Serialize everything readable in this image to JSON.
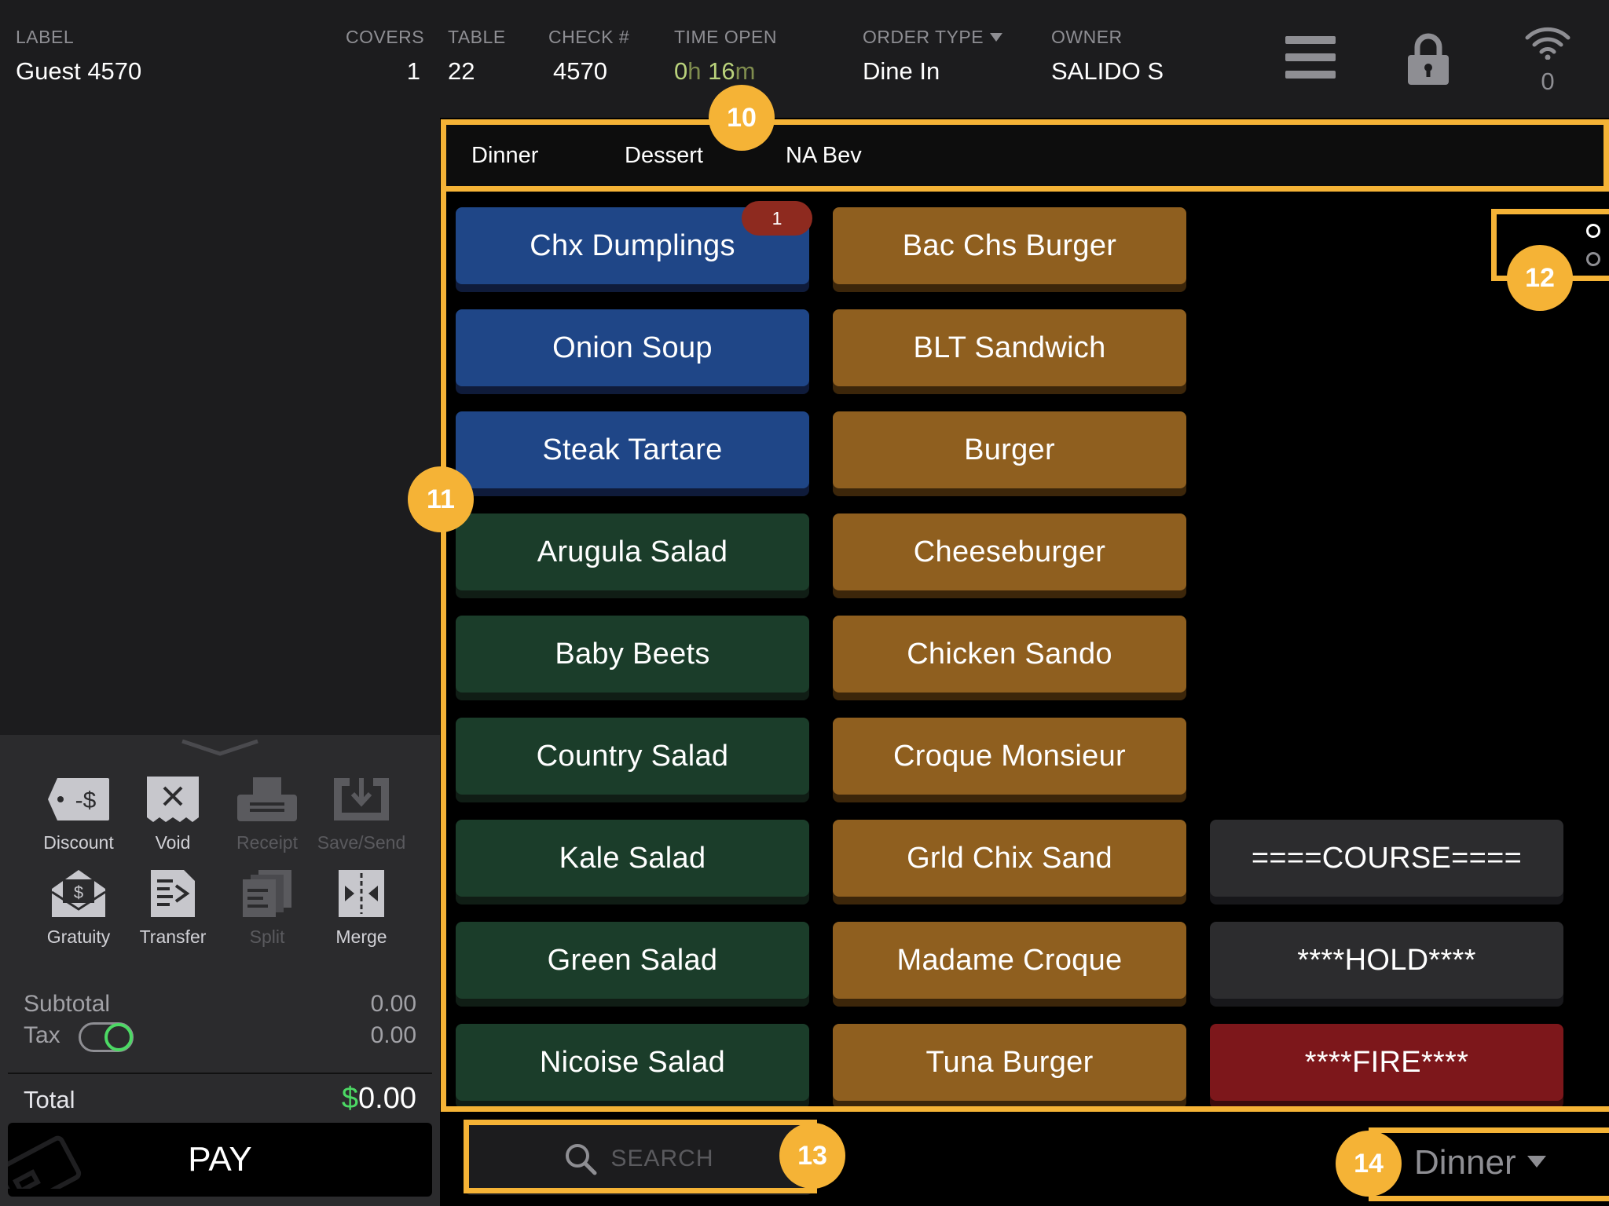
{
  "header": {
    "label": {
      "title": "LABEL",
      "value": "Guest 4570"
    },
    "covers": {
      "title": "COVERS",
      "value": "1"
    },
    "table": {
      "title": "TABLE",
      "value": "22"
    },
    "check": {
      "title": "CHECK #",
      "value": "4570"
    },
    "time_open": {
      "title": "TIME OPEN",
      "hours": "0",
      "hours_unit": "h",
      "minutes": "16",
      "minutes_unit": "m"
    },
    "order_type": {
      "title": "ORDER TYPE",
      "value": "Dine In"
    },
    "owner": {
      "title": "OWNER",
      "value": "SALIDO S"
    },
    "icons": {
      "menu": "hamburger-menu-icon",
      "lock": "lock-icon",
      "wifi": "wifi-icon"
    },
    "wifi_count": "0"
  },
  "actions": [
    {
      "label": "Discount",
      "icon": "discount-tag-icon",
      "enabled": true
    },
    {
      "label": "Void",
      "icon": "void-receipt-icon",
      "enabled": true
    },
    {
      "label": "Receipt",
      "icon": "printer-icon",
      "enabled": false
    },
    {
      "label": "Save/Send",
      "icon": "save-send-icon",
      "enabled": false
    },
    {
      "label": "Gratuity",
      "icon": "gratuity-envelope-icon",
      "enabled": true
    },
    {
      "label": "Transfer",
      "icon": "transfer-icon",
      "enabled": true
    },
    {
      "label": "Split",
      "icon": "split-icon",
      "enabled": false
    },
    {
      "label": "Merge",
      "icon": "merge-icon",
      "enabled": true
    }
  ],
  "totals": {
    "subtotal_label": "Subtotal",
    "subtotal_value": "0.00",
    "tax_label": "Tax",
    "tax_value": "0.00",
    "tax_enabled": true,
    "total_label": "Total",
    "total_currency": "$",
    "total_value": "0.00"
  },
  "pay_label": "PAY",
  "categories": [
    "Dinner",
    "Dessert",
    "NA Bev"
  ],
  "items": {
    "column1": [
      {
        "label": "Chx Dumplings",
        "color": "#1f4687"
      },
      {
        "label": "Onion Soup",
        "color": "#1f4687"
      },
      {
        "label": "Steak Tartare",
        "color": "#1f4687"
      },
      {
        "label": "Arugula Salad",
        "color": "#1b3d2a"
      },
      {
        "label": "Baby Beets",
        "color": "#1b3d2a"
      },
      {
        "label": "Country Salad",
        "color": "#1b3d2a"
      },
      {
        "label": "Kale Salad",
        "color": "#1b3d2a"
      },
      {
        "label": "Green Salad",
        "color": "#1b3d2a"
      },
      {
        "label": "Nicoise Salad",
        "color": "#1b3d2a"
      }
    ],
    "column2": [
      {
        "label": "Bac Chs Burger",
        "color": "#8f5f1f"
      },
      {
        "label": "BLT Sandwich",
        "color": "#8f5f1f"
      },
      {
        "label": "Burger",
        "color": "#8f5f1f"
      },
      {
        "label": "Cheeseburger",
        "color": "#8f5f1f"
      },
      {
        "label": "Chicken Sando",
        "color": "#8f5f1f"
      },
      {
        "label": "Croque Monsieur",
        "color": "#8f5f1f"
      },
      {
        "label": "Grld Chix Sand",
        "color": "#8f5f1f"
      },
      {
        "label": "Madame Croque",
        "color": "#8f5f1f"
      },
      {
        "label": "Tuna Burger",
        "color": "#8f5f1f"
      }
    ],
    "column3": [
      {
        "label": "====COURSE====",
        "color": "#2c2c2e"
      },
      {
        "label": "****HOLD****",
        "color": "#2c2c2e"
      },
      {
        "label": "****FIRE****",
        "color": "#7d171b"
      }
    ],
    "badge_count": "1"
  },
  "pagination": {
    "pages": 2,
    "current": 1
  },
  "search": {
    "placeholder": "SEARCH"
  },
  "menu_selector": {
    "value": "Dinner"
  },
  "callouts": [
    "10",
    "11",
    "12",
    "13",
    "14"
  ],
  "colors": {
    "accent_highlight": "#f5b336",
    "toggle_on": "#4cd964",
    "time_open": "#b9d27b",
    "badge": "#8e2a1f"
  }
}
